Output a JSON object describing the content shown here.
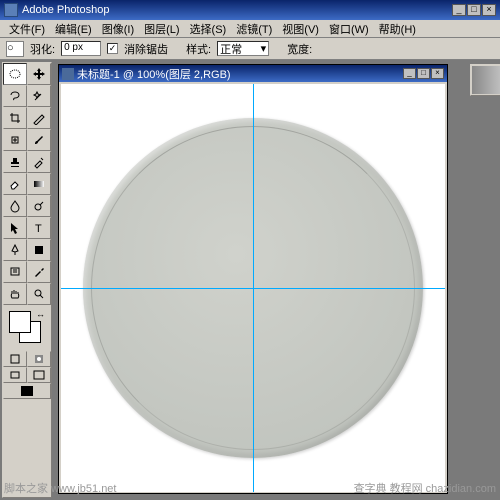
{
  "app": {
    "title": "Adobe Photoshop"
  },
  "menu": [
    "文件(F)",
    "编辑(E)",
    "图像(I)",
    "图层(L)",
    "选择(S)",
    "滤镜(T)",
    "视图(V)",
    "窗口(W)",
    "帮助(H)"
  ],
  "options": {
    "feather_label": "羽化:",
    "feather_value": "0 px",
    "antialias_checked": "✓",
    "antialias_label": "消除锯齿",
    "style_label": "样式:",
    "style_value": "正常",
    "width_label": "宽度:"
  },
  "doc": {
    "title": "未标题-1 @ 100%(图层 2,RGB)"
  },
  "watermarks": {
    "left": "脚本之家\nwww.jb51.net",
    "right": "查字典 教程网\nchazidian.com"
  },
  "tools": {
    "marquee": "rect-marquee",
    "move": "move",
    "lasso": "lasso",
    "wand": "magic-wand",
    "crop": "crop",
    "slice": "slice",
    "heal": "healing",
    "brush": "brush",
    "stamp": "clone-stamp",
    "history": "history-brush",
    "eraser": "eraser",
    "fill": "gradient",
    "blur": "blur",
    "dodge": "dodge",
    "path": "path-select",
    "type": "type",
    "pen": "pen",
    "shape": "shape",
    "notes": "notes",
    "eyedrop": "eyedropper",
    "hand": "hand",
    "zoom": "zoom"
  },
  "colors": {
    "fg": "#ffffff",
    "bg": "#ffffff"
  }
}
